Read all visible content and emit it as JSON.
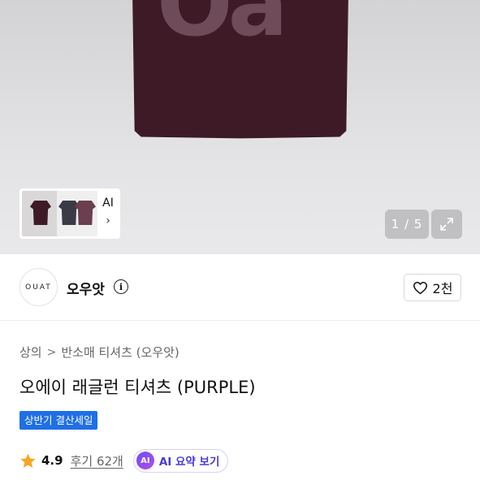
{
  "gallery": {
    "shirt_logo_text": "Oa",
    "thumbnail_ai_label": "AI",
    "thumbnail_chevron": "›",
    "counter": "1 / 5",
    "expand_icon": "expand-icon"
  },
  "brand": {
    "logo_text": "OUAT",
    "name": "오우앗",
    "info_icon": "i",
    "like_count": "2천"
  },
  "breadcrumb": [
    "상의",
    "반소매 티셔츠 (오우앗)"
  ],
  "breadcrumb_separator": ">",
  "product": {
    "title": "오에이 래글런 티셔츠 (PURPLE)",
    "badge": "상반기 결산세일",
    "rating": "4.9",
    "reviews": "후기 62개",
    "ai_badge": "AI",
    "ai_summary_label": "AI 요약 보기"
  },
  "colors": {
    "shirt": "#3e1a27",
    "badge": "#1f6fe5",
    "star": "#f5a623",
    "ai_accent": "#4b3bd6"
  }
}
